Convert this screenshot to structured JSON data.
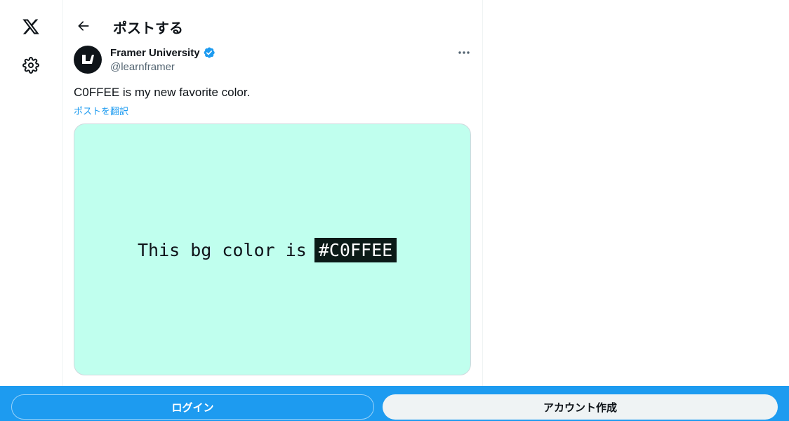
{
  "app": {
    "logo_icon": "x-logo-icon",
    "settings_icon": "gear-icon"
  },
  "header": {
    "back_icon": "arrow-left-icon",
    "title": "ポストする"
  },
  "post": {
    "author": {
      "name": "Framer University",
      "handle": "@learnframer",
      "verified": true,
      "verified_color": "#1d9bf0",
      "avatar_icon": "framer-university-logo"
    },
    "more_icon": "more-horizontal-icon",
    "text": "C0FFEE is my new favorite color.",
    "translate_label": "ポストを翻訳",
    "media": {
      "background_color": "#c0ffee",
      "caption_prefix": "This bg color is",
      "caption_highlight": "#C0FFEE"
    }
  },
  "bottom_bar": {
    "background_color": "#1d9bf0",
    "login_label": "ログイン",
    "signup_label": "アカウント作成"
  }
}
